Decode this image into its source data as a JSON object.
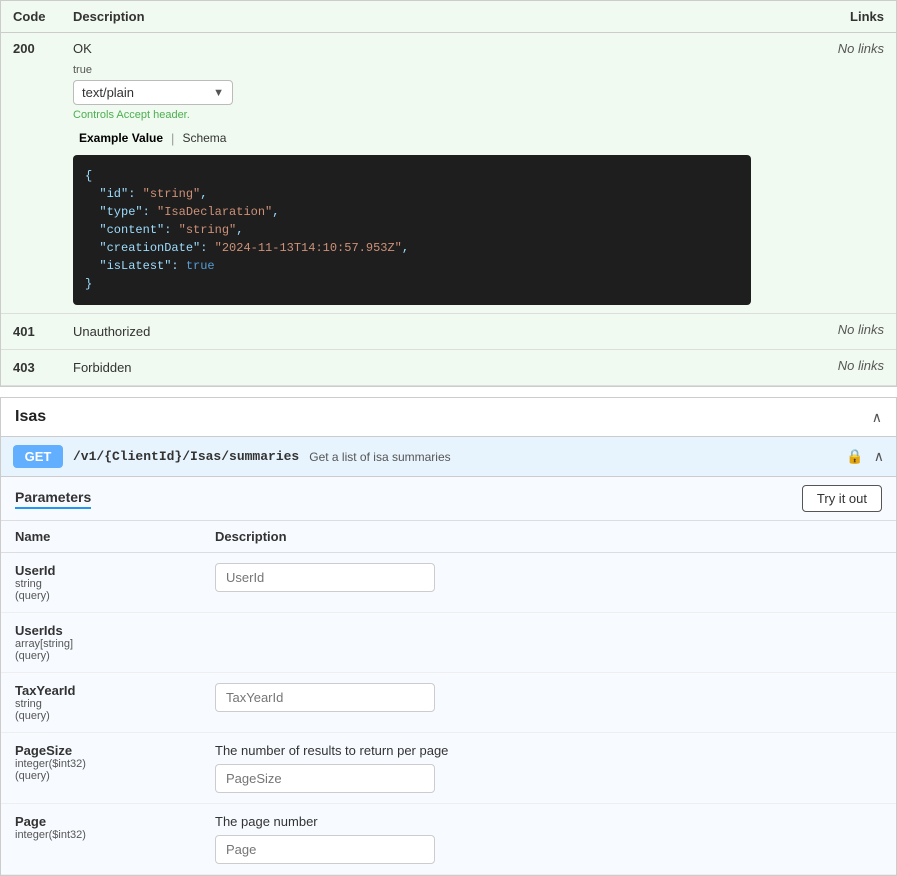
{
  "responses_table": {
    "headers": {
      "code": "Code",
      "description": "Description",
      "links": "Links"
    },
    "rows": [
      {
        "code": "200",
        "description": "OK",
        "links": "No links",
        "has_media": true,
        "media_type": "text/plain",
        "controls_label": "Controls Accept header.",
        "example_tab": "Example Value",
        "schema_tab": "Schema",
        "code_block": "{\n  \"id\": \"string\",\n  \"type\": \"IsaDeclaration\",\n  \"content\": \"string\",\n  \"creationDate\": \"2024-11-13T14:10:57.953Z\",\n  \"isLatest\": true\n}"
      },
      {
        "code": "401",
        "description": "Unauthorized",
        "links": "No links"
      },
      {
        "code": "403",
        "description": "Forbidden",
        "links": "No links"
      }
    ]
  },
  "isas_section": {
    "title": "Isas",
    "chevron": "∧",
    "endpoint": {
      "method": "GET",
      "path": "/v1/{ClientId}/Isas/summaries",
      "description": "Get a list of isa summaries",
      "lock_icon": "🔒",
      "chevron": "∧"
    },
    "parameters_tab": "Parameters",
    "try_it_out_label": "Try it out",
    "params_headers": {
      "name": "Name",
      "description": "Description"
    },
    "params": [
      {
        "name": "UserId",
        "type": "string",
        "scope": "(query)",
        "description": "",
        "placeholder": "UserId"
      },
      {
        "name": "UserIds",
        "type": "array[string]",
        "scope": "(query)",
        "description": "",
        "placeholder": ""
      },
      {
        "name": "TaxYearId",
        "type": "string",
        "scope": "(query)",
        "description": "",
        "placeholder": "TaxYearId"
      },
      {
        "name": "PageSize",
        "type": "integer($int32)",
        "scope": "(query)",
        "description": "The number of results to return per page",
        "placeholder": "PageSize"
      },
      {
        "name": "Page",
        "type": "integer($int32)",
        "scope": "",
        "description": "The page number",
        "placeholder": "Page"
      }
    ]
  }
}
